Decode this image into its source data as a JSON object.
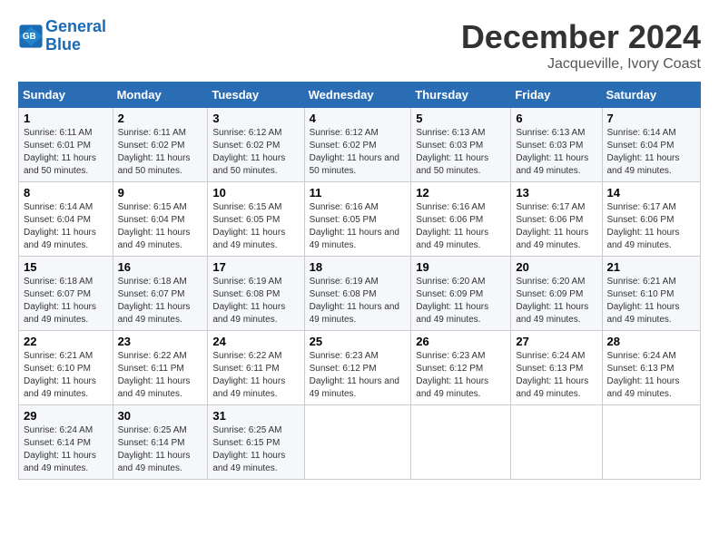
{
  "logo": {
    "line1": "General",
    "line2": "Blue"
  },
  "title": "December 2024",
  "location": "Jacqueville, Ivory Coast",
  "days_of_week": [
    "Sunday",
    "Monday",
    "Tuesday",
    "Wednesday",
    "Thursday",
    "Friday",
    "Saturday"
  ],
  "weeks": [
    [
      {
        "day": "1",
        "sunrise": "6:11 AM",
        "sunset": "6:01 PM",
        "daylight": "11 hours and 50 minutes."
      },
      {
        "day": "2",
        "sunrise": "6:11 AM",
        "sunset": "6:02 PM",
        "daylight": "11 hours and 50 minutes."
      },
      {
        "day": "3",
        "sunrise": "6:12 AM",
        "sunset": "6:02 PM",
        "daylight": "11 hours and 50 minutes."
      },
      {
        "day": "4",
        "sunrise": "6:12 AM",
        "sunset": "6:02 PM",
        "daylight": "11 hours and 50 minutes."
      },
      {
        "day": "5",
        "sunrise": "6:13 AM",
        "sunset": "6:03 PM",
        "daylight": "11 hours and 50 minutes."
      },
      {
        "day": "6",
        "sunrise": "6:13 AM",
        "sunset": "6:03 PM",
        "daylight": "11 hours and 49 minutes."
      },
      {
        "day": "7",
        "sunrise": "6:14 AM",
        "sunset": "6:04 PM",
        "daylight": "11 hours and 49 minutes."
      }
    ],
    [
      {
        "day": "8",
        "sunrise": "6:14 AM",
        "sunset": "6:04 PM",
        "daylight": "11 hours and 49 minutes."
      },
      {
        "day": "9",
        "sunrise": "6:15 AM",
        "sunset": "6:04 PM",
        "daylight": "11 hours and 49 minutes."
      },
      {
        "day": "10",
        "sunrise": "6:15 AM",
        "sunset": "6:05 PM",
        "daylight": "11 hours and 49 minutes."
      },
      {
        "day": "11",
        "sunrise": "6:16 AM",
        "sunset": "6:05 PM",
        "daylight": "11 hours and 49 minutes."
      },
      {
        "day": "12",
        "sunrise": "6:16 AM",
        "sunset": "6:06 PM",
        "daylight": "11 hours and 49 minutes."
      },
      {
        "day": "13",
        "sunrise": "6:17 AM",
        "sunset": "6:06 PM",
        "daylight": "11 hours and 49 minutes."
      },
      {
        "day": "14",
        "sunrise": "6:17 AM",
        "sunset": "6:06 PM",
        "daylight": "11 hours and 49 minutes."
      }
    ],
    [
      {
        "day": "15",
        "sunrise": "6:18 AM",
        "sunset": "6:07 PM",
        "daylight": "11 hours and 49 minutes."
      },
      {
        "day": "16",
        "sunrise": "6:18 AM",
        "sunset": "6:07 PM",
        "daylight": "11 hours and 49 minutes."
      },
      {
        "day": "17",
        "sunrise": "6:19 AM",
        "sunset": "6:08 PM",
        "daylight": "11 hours and 49 minutes."
      },
      {
        "day": "18",
        "sunrise": "6:19 AM",
        "sunset": "6:08 PM",
        "daylight": "11 hours and 49 minutes."
      },
      {
        "day": "19",
        "sunrise": "6:20 AM",
        "sunset": "6:09 PM",
        "daylight": "11 hours and 49 minutes."
      },
      {
        "day": "20",
        "sunrise": "6:20 AM",
        "sunset": "6:09 PM",
        "daylight": "11 hours and 49 minutes."
      },
      {
        "day": "21",
        "sunrise": "6:21 AM",
        "sunset": "6:10 PM",
        "daylight": "11 hours and 49 minutes."
      }
    ],
    [
      {
        "day": "22",
        "sunrise": "6:21 AM",
        "sunset": "6:10 PM",
        "daylight": "11 hours and 49 minutes."
      },
      {
        "day": "23",
        "sunrise": "6:22 AM",
        "sunset": "6:11 PM",
        "daylight": "11 hours and 49 minutes."
      },
      {
        "day": "24",
        "sunrise": "6:22 AM",
        "sunset": "6:11 PM",
        "daylight": "11 hours and 49 minutes."
      },
      {
        "day": "25",
        "sunrise": "6:23 AM",
        "sunset": "6:12 PM",
        "daylight": "11 hours and 49 minutes."
      },
      {
        "day": "26",
        "sunrise": "6:23 AM",
        "sunset": "6:12 PM",
        "daylight": "11 hours and 49 minutes."
      },
      {
        "day": "27",
        "sunrise": "6:24 AM",
        "sunset": "6:13 PM",
        "daylight": "11 hours and 49 minutes."
      },
      {
        "day": "28",
        "sunrise": "6:24 AM",
        "sunset": "6:13 PM",
        "daylight": "11 hours and 49 minutes."
      }
    ],
    [
      {
        "day": "29",
        "sunrise": "6:24 AM",
        "sunset": "6:14 PM",
        "daylight": "11 hours and 49 minutes."
      },
      {
        "day": "30",
        "sunrise": "6:25 AM",
        "sunset": "6:14 PM",
        "daylight": "11 hours and 49 minutes."
      },
      {
        "day": "31",
        "sunrise": "6:25 AM",
        "sunset": "6:15 PM",
        "daylight": "11 hours and 49 minutes."
      },
      null,
      null,
      null,
      null
    ]
  ]
}
